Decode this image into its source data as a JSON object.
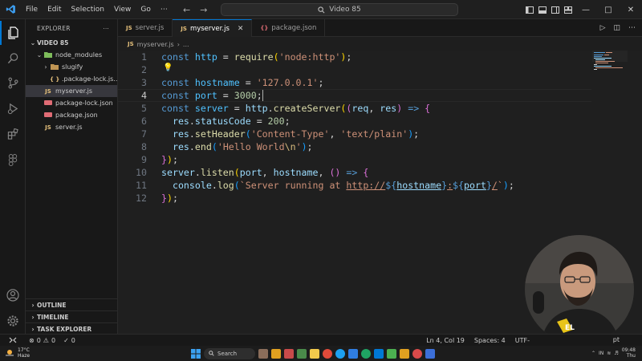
{
  "titlebar": {
    "menu": [
      "File",
      "Edit",
      "Selection",
      "View",
      "Go",
      "⋯"
    ],
    "search_text": "Video 85",
    "back": "←",
    "forward": "→"
  },
  "explorer": {
    "title": "EXPLORER",
    "more": "⋯",
    "root": "VIDEO 85",
    "tree": [
      {
        "label": "node_modules",
        "icon": "folder-icon",
        "chev": "⌄"
      },
      {
        "label": "slugify",
        "icon": "folder-icon",
        "chev": "›"
      },
      {
        "label": ".package-lock.js...",
        "icon": "json-brace-icon"
      },
      {
        "label": "myserver.js",
        "icon": "js-file-icon",
        "badge": "JS"
      },
      {
        "label": "package-lock.json",
        "icon": "json-file-icon"
      },
      {
        "label": "package.json",
        "icon": "json-file-icon"
      },
      {
        "label": "server.js",
        "icon": "js-file-icon",
        "badge": "JS"
      }
    ],
    "sections": [
      "OUTLINE",
      "TIMELINE",
      "TASK EXPLORER"
    ]
  },
  "tabs": [
    {
      "label": "server.js",
      "badge": "JS"
    },
    {
      "label": "myserver.js",
      "badge": "JS",
      "active": true
    },
    {
      "label": "package.json",
      "badge": "{}"
    }
  ],
  "breadcrumb": {
    "badge": "JS",
    "file": "myserver.js",
    "sep": "›",
    "more": "..."
  },
  "editor": {
    "line_numbers": [
      "1",
      "2",
      "3",
      "4",
      "5",
      "6",
      "7",
      "8",
      "9",
      "10",
      "11",
      "12"
    ],
    "current_line": "4",
    "code": [
      "const http = require('node:http');",
      "",
      "const hostname = '127.0.0.1';",
      "const port = 3000;",
      "const server = http.createServer((req, res) => {",
      "  res.statusCode = 200;",
      "  res.setHeader('Content-Type', 'text/plain');",
      "  res.end('Hello World\\n');",
      "});",
      "server.listen(port, hostname, () => {",
      "  console.log(`Server running at http://${hostname}:${port}/`);",
      "});"
    ]
  },
  "statusbar": {
    "errors": "0",
    "warnings": "0",
    "ports": "0",
    "position": "Ln 4, Col 19",
    "spaces": "Spaces: 4",
    "encoding": "UTF-",
    "lang_tail": "pt"
  },
  "taskbar": {
    "temp": "17°C",
    "weather": "Haze",
    "search": "Search",
    "time": "09:48",
    "day": "Thu",
    "lang": "IN"
  },
  "colors": {
    "accent": "#0078d4",
    "bg": "#1f1f1f",
    "sidebar": "#181818"
  }
}
